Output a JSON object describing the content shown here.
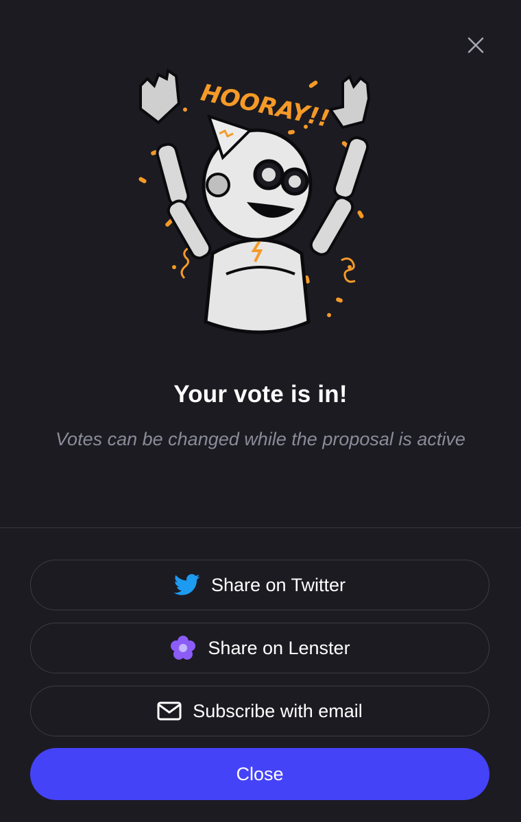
{
  "modal": {
    "title": "Your vote is in!",
    "subtitle": "Votes can be changed while the proposal is active",
    "illustration_text": "HOORAY!!",
    "illustration_icon": "celebrating-robot-illustration",
    "close_icon": "close-icon"
  },
  "actions": [
    {
      "label": "Share on Twitter",
      "icon": "twitter-icon",
      "icon_color": "#1d9bf0"
    },
    {
      "label": "Share on Lenster",
      "icon": "lenster-flower-icon",
      "icon_color": "#8b5cf6"
    },
    {
      "label": "Subscribe with email",
      "icon": "mail-icon",
      "icon_color": "#ffffff"
    }
  ],
  "close_button": {
    "label": "Close",
    "color": "#4543f8"
  },
  "colors": {
    "background": "#1c1b22",
    "accent_orange": "#f59a28",
    "muted_text": "#8a8c98"
  }
}
